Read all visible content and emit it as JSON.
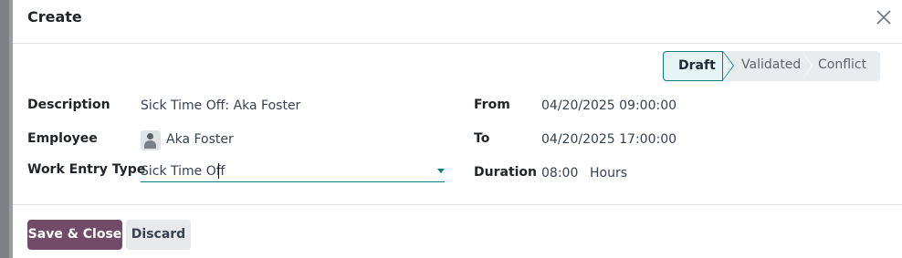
{
  "modal": {
    "title": "Create"
  },
  "statusbar": {
    "stages": [
      "Draft",
      "Validated",
      "Conflict"
    ],
    "active": "Draft"
  },
  "form": {
    "description": {
      "label": "Description",
      "value": "Sick Time Off: Aka Foster"
    },
    "employee": {
      "label": "Employee",
      "value": "Aka Foster"
    },
    "work_entry_type": {
      "label": "Work Entry Type",
      "value": "Sick Time Off"
    },
    "from": {
      "label": "From",
      "value": "04/20/2025 09:00:00"
    },
    "to": {
      "label": "To",
      "value": "04/20/2025 17:00:00"
    },
    "duration": {
      "label": "Duration",
      "value": "08:00",
      "unit": "Hours"
    }
  },
  "footer": {
    "save_label": "Save & Close",
    "discard_label": "Discard"
  },
  "colors": {
    "primary": "#714b67",
    "accent": "#017e84"
  }
}
